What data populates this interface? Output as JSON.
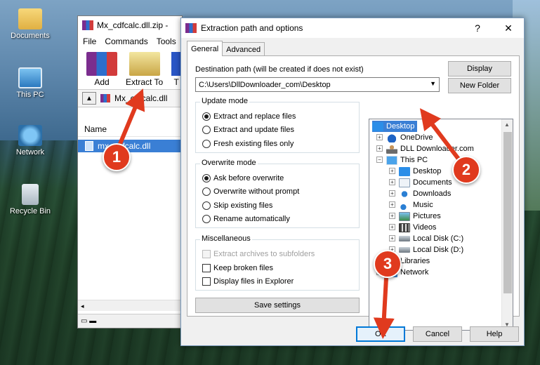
{
  "desktop": {
    "icons": [
      {
        "label": "Documents",
        "icon": "folder-icon"
      },
      {
        "label": "This PC",
        "icon": "computer-icon"
      },
      {
        "label": "Network",
        "icon": "network-icon"
      },
      {
        "label": "Recycle Bin",
        "icon": "recycle-bin-icon"
      }
    ]
  },
  "winrar": {
    "title": "Mx_cdfcalc.dll.zip -",
    "menu": [
      "File",
      "Commands",
      "Tools"
    ],
    "toolbar": {
      "add": "Add",
      "extract_to": "Extract To",
      "third": "T"
    },
    "path": "Mx_cdfcalc.dll",
    "column_name": "Name",
    "file": "mx_cdfcalc.dll"
  },
  "dialog": {
    "title": "Extraction path and options",
    "help_glyph": "?",
    "close_glyph": "✕",
    "tabs": [
      "General",
      "Advanced"
    ],
    "destination_label": "Destination path (will be created if does not exist)",
    "destination_value": "C:\\Users\\DllDownloader_com\\Desktop",
    "display_button": "Display",
    "new_folder_button": "New Folder",
    "update_mode": {
      "title": "Update mode",
      "options": [
        "Extract and replace files",
        "Extract and update files",
        "Fresh existing files only"
      ],
      "selected": 0
    },
    "overwrite_mode": {
      "title": "Overwrite mode",
      "options": [
        "Ask before overwrite",
        "Overwrite without prompt",
        "Skip existing files",
        "Rename automatically"
      ],
      "selected": 0
    },
    "misc": {
      "title": "Miscellaneous",
      "options": [
        "Extract archives to subfolders",
        "Keep broken files",
        "Display files in Explorer"
      ]
    },
    "save_settings": "Save settings",
    "tree": {
      "desktop": "Desktop",
      "onedrive": "OneDrive",
      "dlldownloader": "DLL Downloader.com",
      "this_pc": "This PC",
      "pc_desktop": "Desktop",
      "documents": "Documents",
      "downloads": "Downloads",
      "music": "Music",
      "pictures": "Pictures",
      "videos": "Videos",
      "local_c": "Local Disk (C:)",
      "local_d": "Local Disk (D:)",
      "libraries": "Libraries",
      "network": "Network"
    },
    "ok": "OK",
    "cancel": "Cancel",
    "help": "Help"
  },
  "callouts": [
    "1",
    "2",
    "3"
  ],
  "colors": {
    "callout": "#e03a1e",
    "selection": "#3a7fd5",
    "primary_border": "#0078d7"
  }
}
